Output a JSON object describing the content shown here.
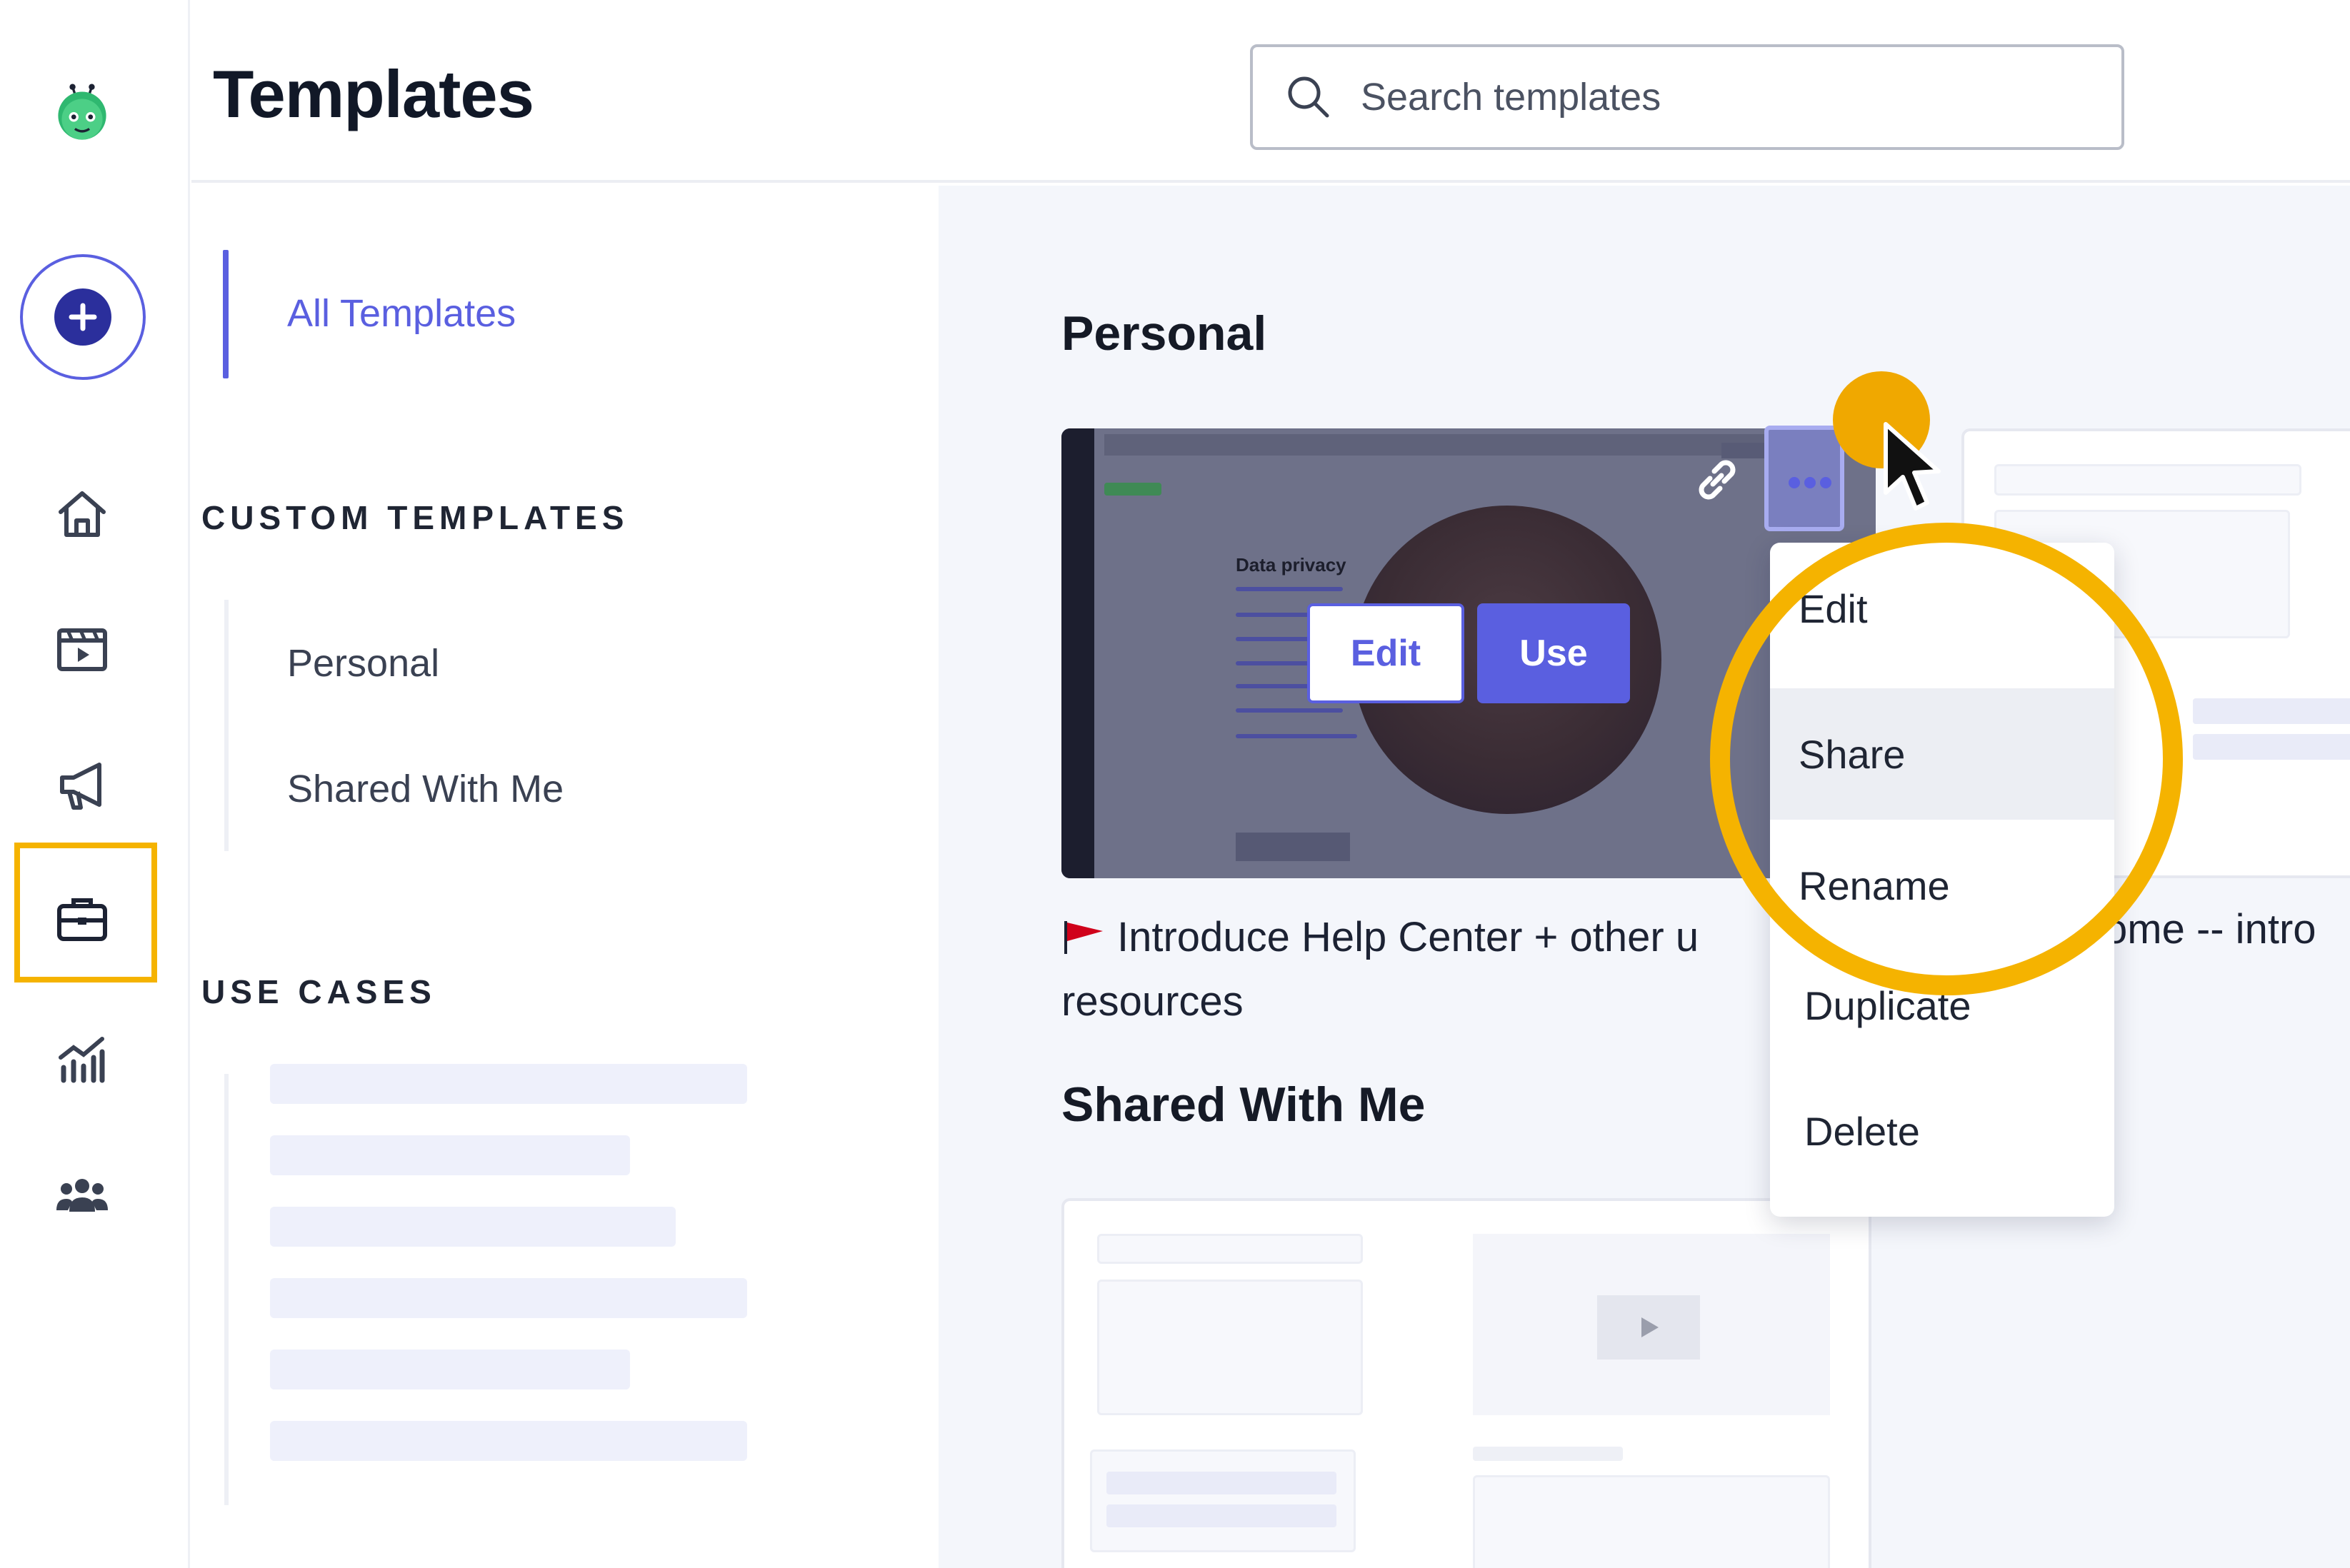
{
  "app": {
    "page_title": "Templates"
  },
  "search": {
    "placeholder": "Search templates"
  },
  "rail": {
    "items": [
      {
        "name": "logo",
        "icon": "robot-logo-icon"
      },
      {
        "name": "create",
        "icon": "plus-icon"
      },
      {
        "name": "home",
        "icon": "home-icon"
      },
      {
        "name": "videos",
        "icon": "video-library-icon"
      },
      {
        "name": "campaigns",
        "icon": "megaphone-icon"
      },
      {
        "name": "templates",
        "icon": "briefcase-icon",
        "active": true
      },
      {
        "name": "analytics",
        "icon": "analytics-icon"
      },
      {
        "name": "team",
        "icon": "team-icon"
      }
    ]
  },
  "nav": {
    "all_templates": "All Templates",
    "custom_heading": "CUSTOM TEMPLATES",
    "custom_items": [
      "Personal",
      "Shared With Me"
    ],
    "use_cases_heading": "USE CASES"
  },
  "main": {
    "personal_heading": "Personal",
    "shared_heading": "Shared With Me",
    "card": {
      "title": "Introduce Help Center + other u resources",
      "title_line1": "Introduce Help Center + other u",
      "title_line2": "resources",
      "edit_label": "Edit",
      "use_label": "Use",
      "thumb_heading": "Data privacy"
    },
    "card2_title_fragment": "ome -- intro"
  },
  "menu": {
    "items": [
      "Edit",
      "Share",
      "Rename",
      "Duplicate",
      "Delete"
    ],
    "selected": "Share"
  },
  "colors": {
    "accent": "#5a5fe0",
    "highlight": "#f5b300",
    "click_dot": "#f0a800",
    "flag": "#d0021b"
  }
}
